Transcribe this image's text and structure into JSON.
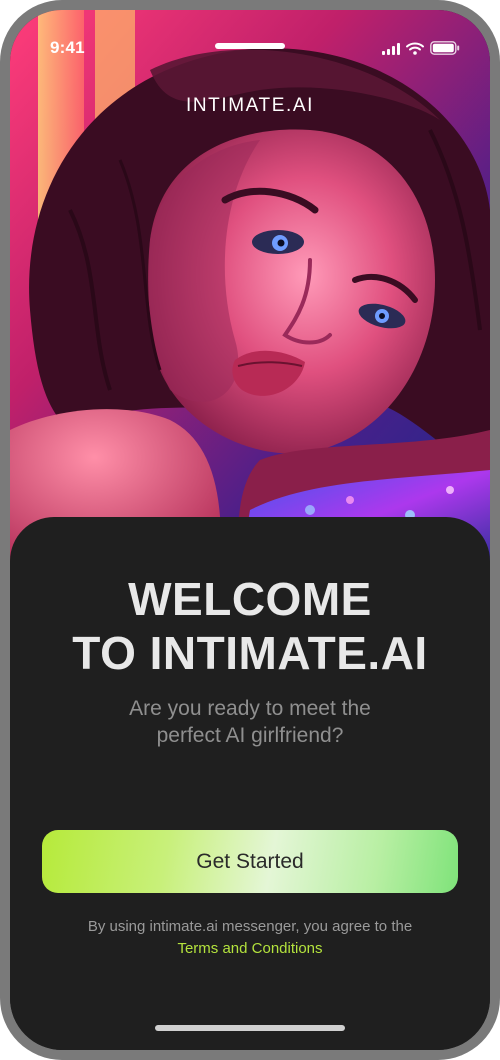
{
  "status_bar": {
    "time": "9:41",
    "icons": [
      "signal-bars-icon",
      "wifi-icon",
      "battery-icon"
    ]
  },
  "brand": {
    "title": "INTIMATE.AI"
  },
  "hero": {
    "image": "neon-lit-portrait-photo"
  },
  "welcome": {
    "heading_line1": "WELCOME",
    "heading_line2": "TO INTIMATE.AI",
    "subtitle_line1": "Are you ready to meet the",
    "subtitle_line2": "perfect AI girlfriend?"
  },
  "cta": {
    "label": "Get Started"
  },
  "terms": {
    "text": "By using intimate.ai messenger, you agree to the",
    "link_label": "Terms and Conditions"
  },
  "colors": {
    "sheet_background": "#1f1f1f",
    "heading": "#e8e8e8",
    "subtitle": "#8f8f8f",
    "accent_link": "#b4e33d",
    "button_gradient_start": "#b6ea3a",
    "button_gradient_end": "#7fe37a"
  }
}
